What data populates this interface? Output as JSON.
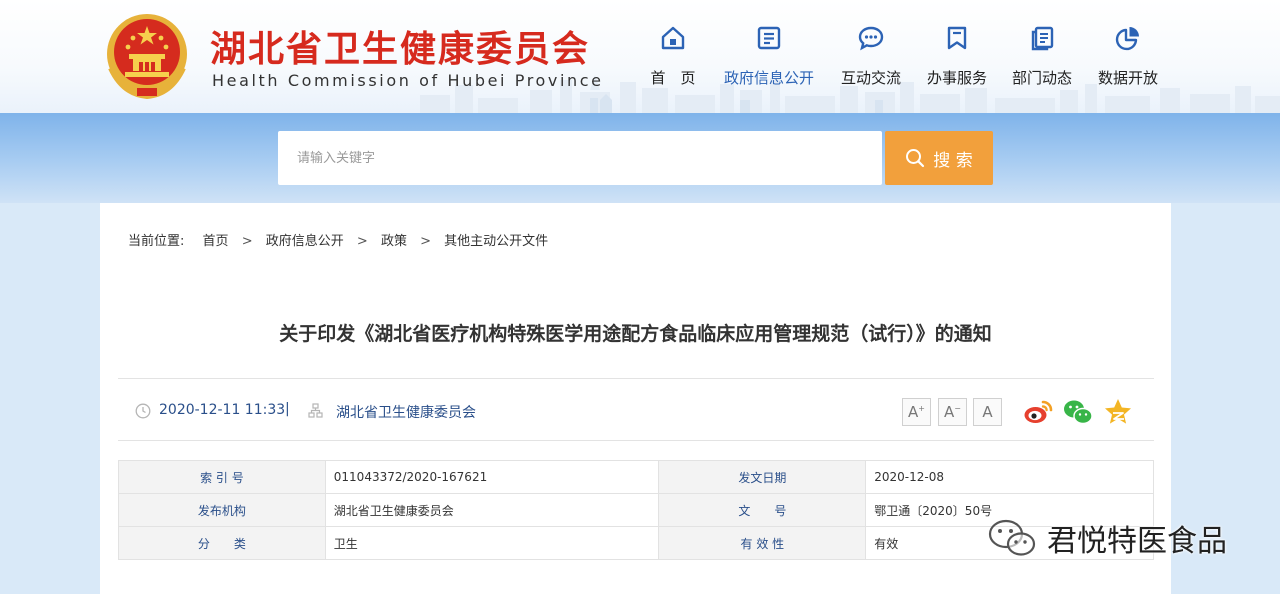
{
  "header": {
    "title_cn": "湖北省卫生健康委员会",
    "title_en": "Health Commission of Hubei Province"
  },
  "nav": [
    {
      "label": "首　页",
      "icon": "home-icon"
    },
    {
      "label": "政府信息公开",
      "icon": "document-icon",
      "active": true
    },
    {
      "label": "互动交流",
      "icon": "chat-icon"
    },
    {
      "label": "办事服务",
      "icon": "bookmark-icon"
    },
    {
      "label": "部门动态",
      "icon": "pages-icon"
    },
    {
      "label": "数据开放",
      "icon": "pie-chart-icon"
    }
  ],
  "search": {
    "placeholder": "请输入关键字",
    "button_label": "搜 索"
  },
  "breadcrumb": {
    "label": "当前位置:",
    "items": [
      "首页",
      "政府信息公开",
      "政策",
      "其他主动公开文件"
    ],
    "separator": ">"
  },
  "article": {
    "title": "关于印发《湖北省医疗机构特殊医学用途配方食品临床应用管理规范（试行）》的通知",
    "date": "2020-12-11 11:33",
    "divider": "|",
    "publisher": "湖北省卫生健康委员会"
  },
  "font_size_buttons": [
    "A",
    "A",
    "A"
  ],
  "info_table": [
    {
      "k1": "索 引 号",
      "v1": "011043372/2020-167621",
      "k2": "发文日期",
      "v2": "2020-12-08"
    },
    {
      "k1": "发布机构",
      "v1": "湖北省卫生健康委员会",
      "k2": "文　　号",
      "v2": "鄂卫通〔2020〕50号"
    },
    {
      "k1": "分　　类",
      "v1": "卫生",
      "k2": "有 效 性",
      "v2": "有效"
    }
  ],
  "watermark": "君悦特医食品",
  "colors": {
    "brand_red": "#d62a1e",
    "nav_active": "#2c63b5",
    "icon_blue": "#2c63b5",
    "search_orange": "#f2a03c",
    "meta_text": "#2a4f8a"
  }
}
